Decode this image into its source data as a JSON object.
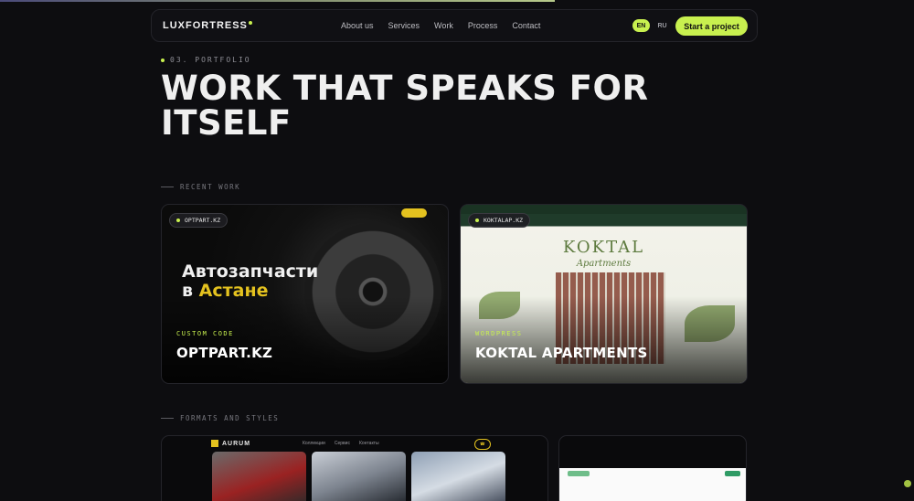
{
  "brand": {
    "name": "LUXFORTRESS",
    "accent": "#c8f04f"
  },
  "nav": {
    "items": [
      "About us",
      "Services",
      "Work",
      "Process",
      "Contact"
    ],
    "lang": [
      "EN",
      "RU"
    ],
    "cta": "Start a project"
  },
  "hero": {
    "kicker": "03. PORTFOLIO",
    "title": "WORK THAT SPEAKS FOR ITSELF"
  },
  "recent": {
    "label": "RECENT WORK",
    "cards": [
      {
        "domain": "OPTPART.KZ",
        "tag": "CUSTOM CODE",
        "title": "OPTPART.KZ",
        "heading_line1": "Автозапчасти",
        "heading_line2_prefix": "в ",
        "heading_line2_highlight": "Астане"
      },
      {
        "domain": "KOKTALAP.KZ",
        "tag": "WORDPRESS",
        "title": "KOKTAL APARTMENTS",
        "logo": "KOKTAL",
        "logo_sub": "Apartments"
      }
    ]
  },
  "formats": {
    "label": "FORMATS AND STYLES",
    "aurum": {
      "name": "AURUM",
      "menu": [
        "Коллекции",
        "Сервис",
        "Контакты"
      ]
    }
  }
}
